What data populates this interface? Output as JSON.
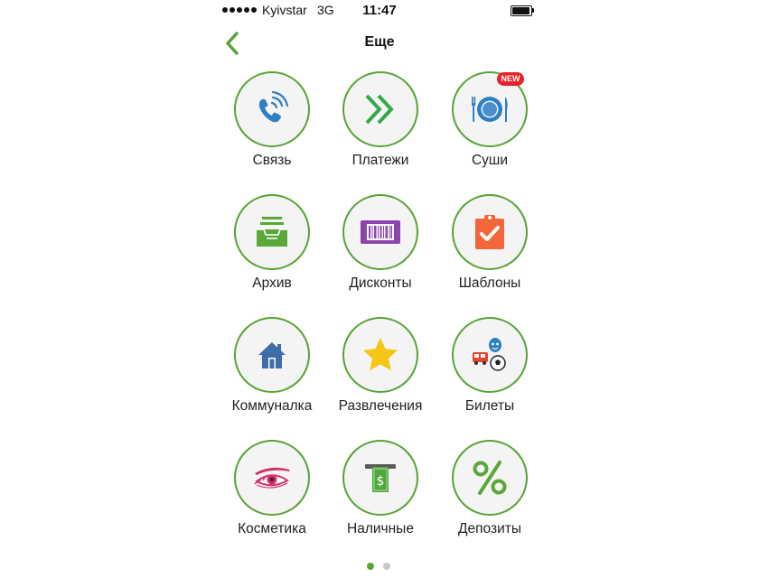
{
  "status_bar": {
    "carrier": "Kyivstar",
    "network": "3G",
    "time": "11:47"
  },
  "header": {
    "title": "Еще",
    "back_icon": "chevron-left-icon",
    "accent_color": "#59a337"
  },
  "grid": {
    "items": [
      {
        "label": "Связь",
        "icon": "phone-icon"
      },
      {
        "label": "Платежи",
        "icon": "double-chevron-right-icon"
      },
      {
        "label": "Суши",
        "icon": "plate-fork-knife-icon",
        "badge": "NEW"
      },
      {
        "label": "Архив",
        "icon": "archive-tray-icon"
      },
      {
        "label": "Дисконты",
        "icon": "barcode-icon"
      },
      {
        "label": "Шаблоны",
        "icon": "clipboard-check-icon"
      },
      {
        "label": "Коммуналка",
        "icon": "house-icon"
      },
      {
        "label": "Развлечения",
        "icon": "star-icon"
      },
      {
        "label": "Билеты",
        "icon": "tickets-icon"
      },
      {
        "label": "Косметика",
        "icon": "eye-lashes-icon"
      },
      {
        "label": "Наличные",
        "icon": "cash-withdrawal-icon"
      },
      {
        "label": "Депозиты",
        "icon": "percent-icon"
      }
    ]
  },
  "pagination": {
    "pages": 2,
    "current": 1
  }
}
